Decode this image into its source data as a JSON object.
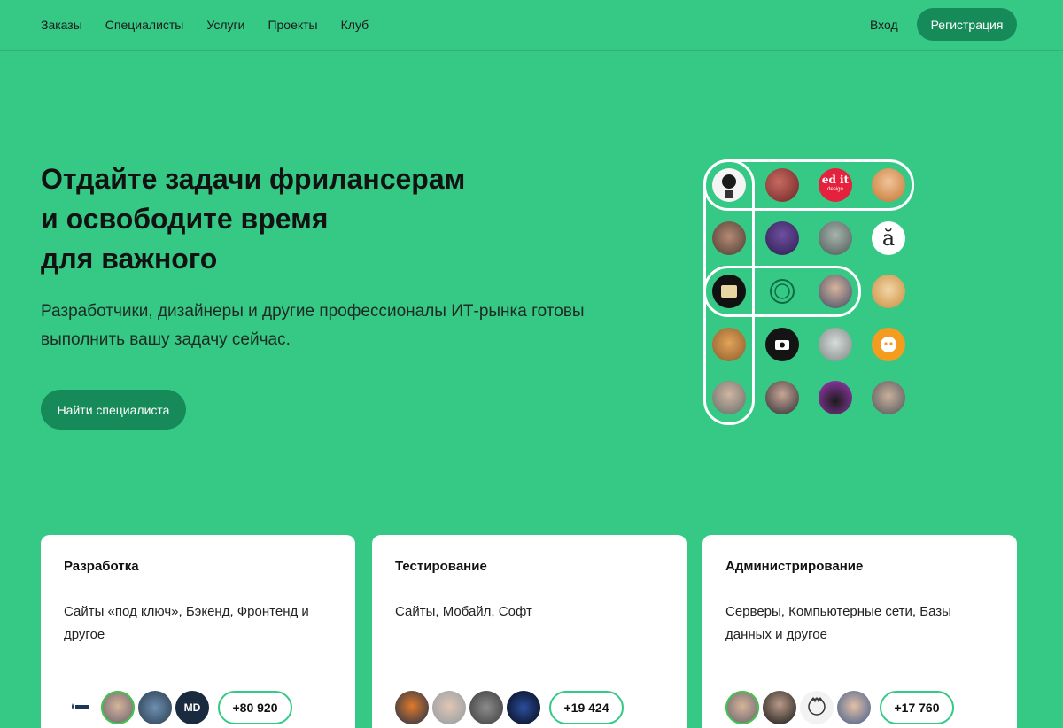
{
  "nav": {
    "items": [
      "Заказы",
      "Специалисты",
      "Услуги",
      "Проекты",
      "Клуб"
    ],
    "login": "Вход",
    "register": "Регистрация"
  },
  "hero": {
    "title_lines": [
      "Отдайте задачи фрилансерам",
      "и освободите время",
      "для важного"
    ],
    "subtitle_lines": [
      "Разработчики, дизайнеры и другие профессионалы ИТ-рынка готовы",
      "выполнить вашу задачу сейчас."
    ],
    "cta": "Найти специалиста"
  },
  "avatar_grid": {
    "logo_text": "ed it",
    "logo_subtext": "design",
    "glyph": "ă"
  },
  "cards": [
    {
      "title": "Разработка",
      "description_lines": [
        "Сайты «под ключ», Бэкенд, Фронтенд и",
        "другое"
      ],
      "badge_text": "MD",
      "count": "+80 920"
    },
    {
      "title": "Тестирование",
      "description_lines": [
        "Сайты, Мобайл, Софт"
      ],
      "count": "+19 424"
    },
    {
      "title": "Администрирование",
      "description_lines": [
        "Серверы, Компьютерные сети, Базы",
        "данных и другое"
      ],
      "count": "+17 760"
    }
  ],
  "colors": {
    "background": "#35c985",
    "button": "#168a59",
    "card": "#ffffff"
  }
}
